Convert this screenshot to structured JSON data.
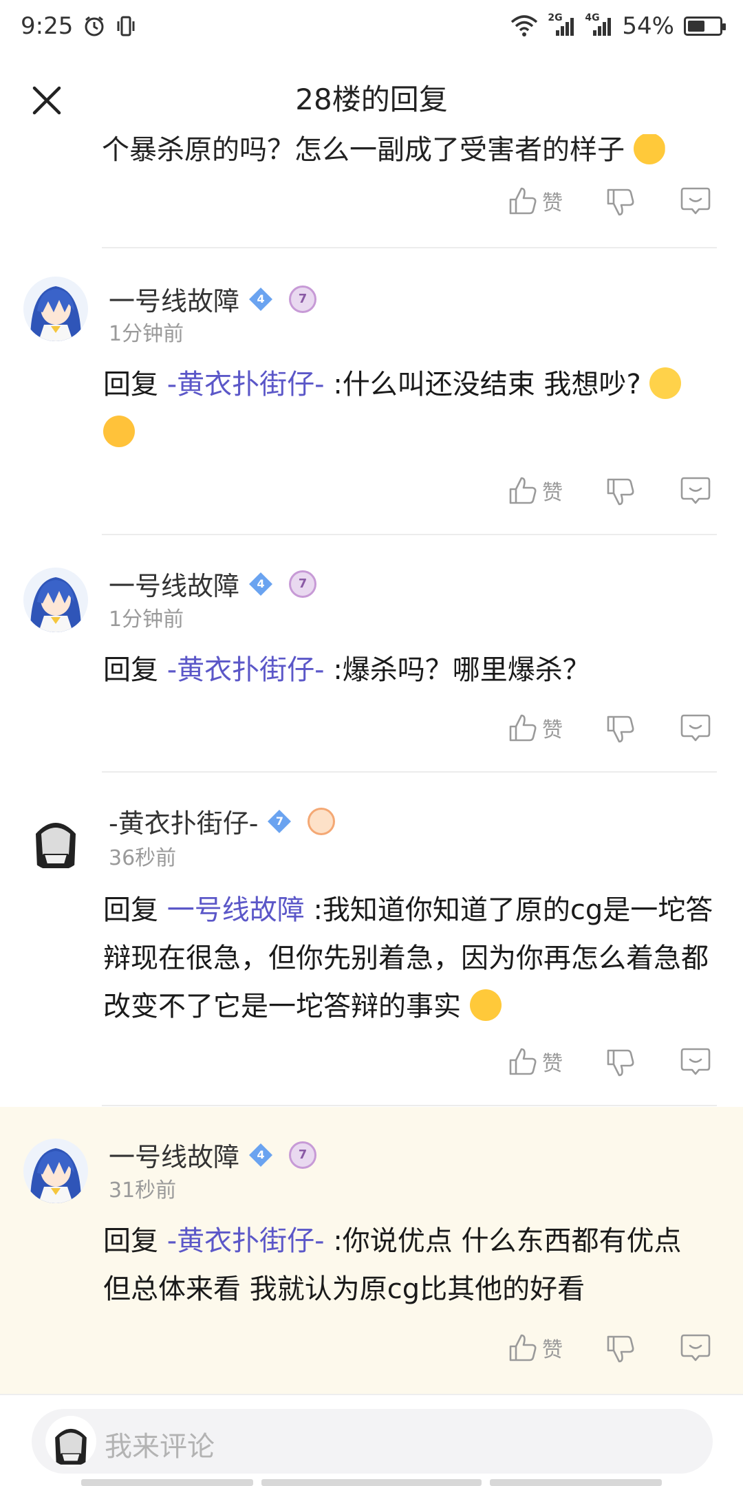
{
  "status_bar": {
    "time": "9:25",
    "net1": "2G",
    "net2": "4G",
    "battery": "54%",
    "battery_level": 0.54
  },
  "header": {
    "title": "28楼的回复"
  },
  "previous_comment_tail": "个暴杀原的吗？怎么一副成了受害者的样子",
  "actions": {
    "like_label": "赞"
  },
  "comments": [
    {
      "username": "一号线故障",
      "level": "4",
      "medal": "7",
      "time": "1分钟前",
      "prefix": "回复",
      "mention": "-黄衣扑街仔-",
      "text": ":什么叫还没结束 我想吵?"
    },
    {
      "username": "一号线故障",
      "level": "4",
      "medal": "7",
      "time": "1分钟前",
      "prefix": "回复",
      "mention": "-黄衣扑街仔-",
      "text": ":爆杀吗？哪里爆杀？"
    },
    {
      "username": "-黄衣扑街仔-",
      "level": "7",
      "time": "36秒前",
      "prefix": "回复",
      "mention": "一号线故障",
      "text": ":我知道你知道了原的cg是一坨答辩现在很急，但你先别着急，因为你再怎么着急都改变不了它是一坨答辩的事实"
    },
    {
      "username": "一号线故障",
      "level": "4",
      "medal": "7",
      "time": "31秒前",
      "prefix": "回复",
      "mention": "-黄衣扑街仔-",
      "text": ":你说优点 什么东西都有优点 但总体来看 我就认为原cg比其他的好看"
    }
  ],
  "input": {
    "placeholder": "我来评论"
  },
  "colors": {
    "mention": "#5b57c8",
    "highlight_bg": "#fdf9ec"
  }
}
